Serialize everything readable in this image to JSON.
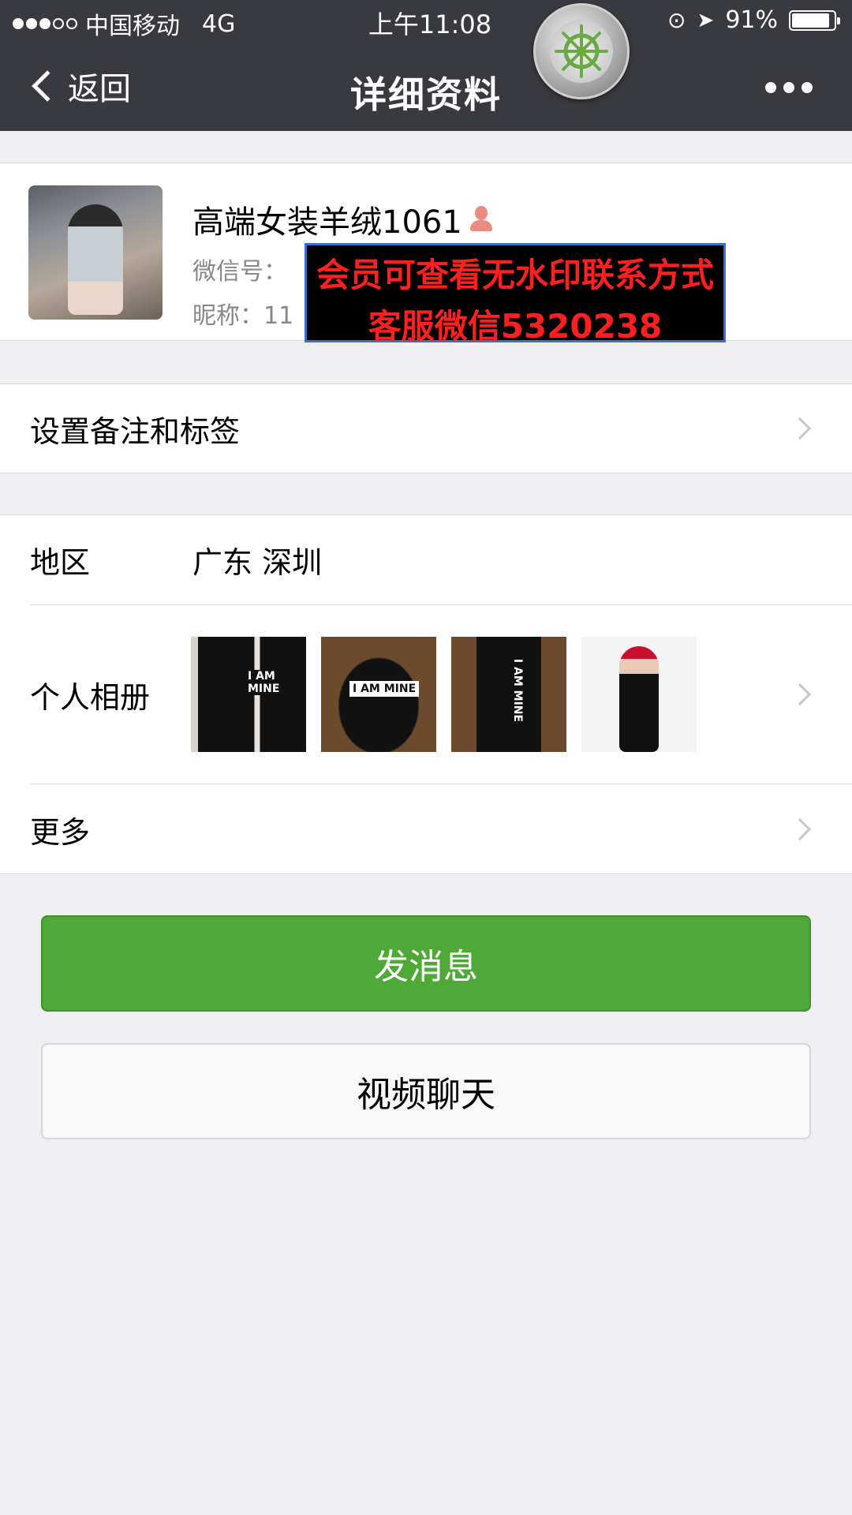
{
  "status_bar": {
    "carrier": "中国移动",
    "network": "4G",
    "time": "上午11:08",
    "battery": "91%",
    "battery_level": 0.91
  },
  "nav": {
    "back_label": "返回",
    "title": "详细资料"
  },
  "profile": {
    "name": "高端女装羊绒1061",
    "wechat_id_label": "微信号：",
    "wechat_id_value": "",
    "nickname_label": "昵称：",
    "nickname_value": "11"
  },
  "watermark": {
    "line1": "会员可查看无水印联系方式",
    "line2": "客服微信5320238"
  },
  "remark_row": {
    "label": "设置备注和标签"
  },
  "region_row": {
    "label": "地区",
    "value": "广东 深圳"
  },
  "album_row": {
    "label": "个人相册",
    "photos": [
      {
        "text": "I AM MINE"
      },
      {
        "text": "I AM MINE"
      },
      {
        "text": "I AM MINE"
      },
      {
        "text": ""
      }
    ]
  },
  "more_row": {
    "label": "更多"
  },
  "buttons": {
    "send_message": "发消息",
    "video_chat": "视频聊天"
  },
  "colors": {
    "nav_bg": "#393a3f",
    "primary_green": "#4fa936",
    "page_bg": "#efeff4",
    "watermark_text": "#ff1f1f"
  },
  "icons": [
    "chevron-left-icon",
    "more-icon",
    "helm-icon",
    "female-icon",
    "chevron-right-icon",
    "battery-icon"
  ]
}
